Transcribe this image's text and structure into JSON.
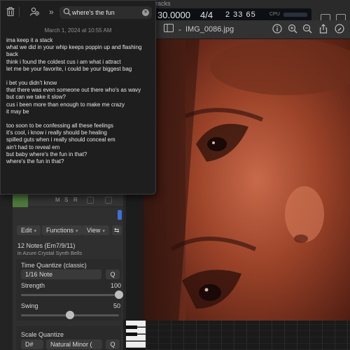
{
  "logic": {
    "tracks_label": "racks",
    "position": "30.0000",
    "time_signature": "4/4",
    "bar_display": "2 33 65",
    "cpu_label": "CPU",
    "track_buttons": [
      "M",
      "S",
      "R"
    ],
    "menus": {
      "edit": "Edit",
      "functions": "Functions",
      "view": "View"
    },
    "region_title": "12 Notes (Em7/9/11)",
    "region_subtitle": "in Azure Crystal Synth Bells",
    "time_quantize": {
      "label": "Time Quantize (classic)",
      "value": "1/16 Note",
      "q_label": "Q"
    },
    "strength": {
      "label": "Strength",
      "value": "100",
      "level": 1.0
    },
    "swing": {
      "label": "Swing",
      "value": "50",
      "level": 0.5
    },
    "scale_quantize": {
      "label": "Scale Quantize",
      "key": "D#",
      "scale": "Natural Minor (",
      "q_label": "Q"
    }
  },
  "preview": {
    "title": "IMG_0086.jpg"
  },
  "notes": {
    "search_value": "where's the fun",
    "date": "March 1, 2024 at 10:55 AM",
    "paragraphs": [
      [
        "ima keep it a stack",
        "what we did in your whip keeps poppin up and flashing",
        "back",
        "think i found the coldest cus i am what i attract",
        "let me be your favorite, i could be your biggest bag"
      ],
      [
        "i bet you didn't know",
        "that there was even someone out there who's as wavy",
        "but can we take it slow?",
        "cus i been more than enough to make me crazy",
        "it may be"
      ],
      [
        "too soon to be confessing all these feelings",
        "it's cool, i know i really should be healing",
        "spilled guts when i really should conceal em",
        "ain't had to reveal em",
        "but baby where's the fun in that?",
        "where's the fun in that?"
      ]
    ]
  },
  "colors": {
    "notes_bg": "#1e1e1e",
    "logic_lcd": "#0d0f14",
    "track_green": "#4d7a3c",
    "accent_blue": "#3d6fd6"
  }
}
